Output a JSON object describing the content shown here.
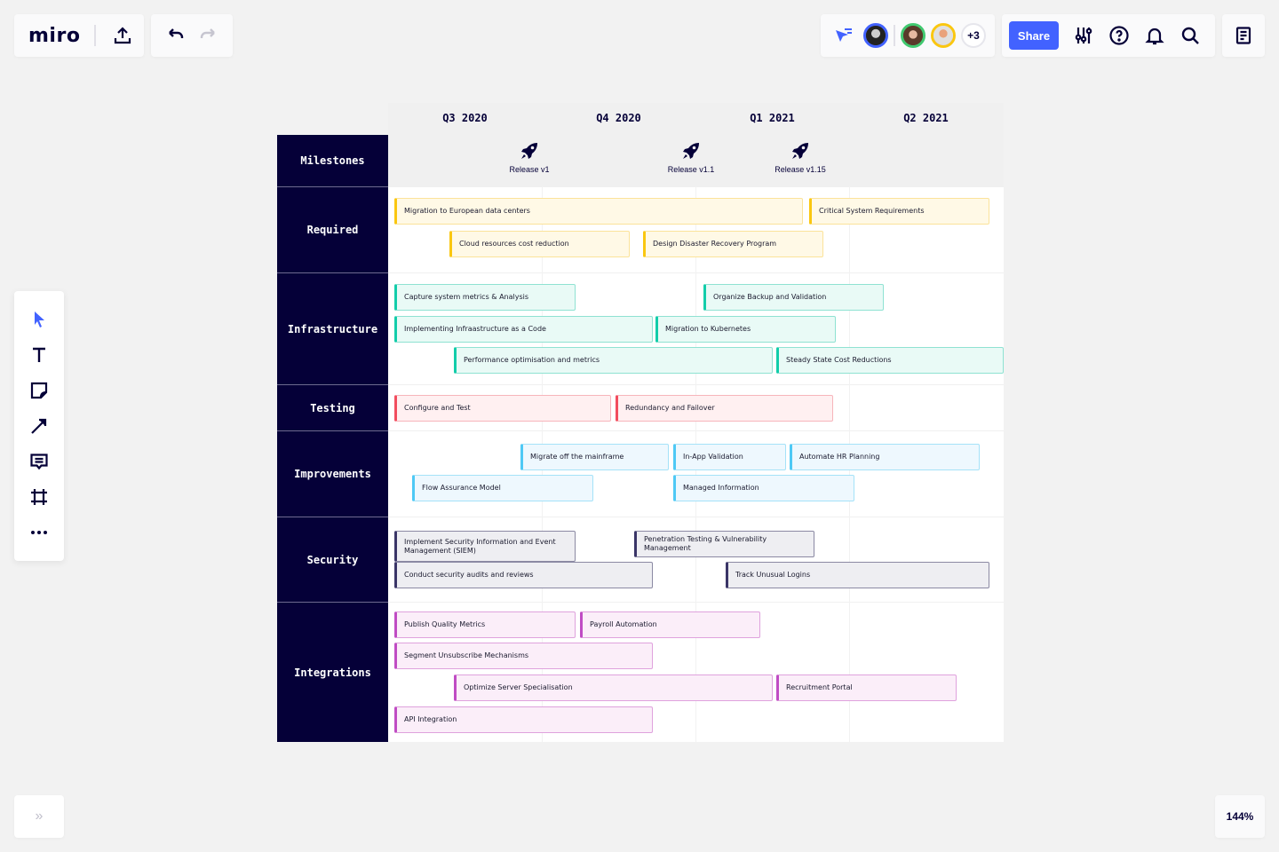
{
  "app": {
    "logo": "miro",
    "share_label": "Share",
    "collaborators_more": "+3",
    "zoom_level": "144%",
    "expand_label": "»"
  },
  "toolbar": {
    "items": [
      "select-tool",
      "text-tool",
      "sticky-note-tool",
      "connection-line-tool",
      "comment-tool",
      "frame-tool",
      "more-tools"
    ]
  },
  "board": {
    "quarters": [
      "Q3 2020",
      "Q4 2020",
      "Q1 2021",
      "Q2 2021"
    ],
    "milestones": [
      {
        "label": "Release v1",
        "icon": "rocket-icon"
      },
      {
        "label": "Release v1.1",
        "icon": "rocket-icon"
      },
      {
        "label": "Release v1.15",
        "icon": "rocket-icon"
      }
    ],
    "lanes": [
      {
        "label": "Milestones"
      },
      {
        "label": "Required",
        "cards": [
          "Migration to European data centers",
          "Critical System Requirements",
          "Cloud resources cost reduction",
          "Design Disaster Recovery Program"
        ]
      },
      {
        "label": "Infrastructure",
        "cards": [
          "Capture system metrics & Analysis",
          "Organize Backup and Validation",
          "Implementing Infraastructure as a Code",
          "Migration to Kubernetes",
          "Performance optimisation and metrics",
          "Steady State Cost Reductions"
        ]
      },
      {
        "label": "Testing",
        "cards": [
          "Configure and Test",
          "Redundancy and Failover"
        ]
      },
      {
        "label": "Improvements",
        "cards": [
          "Migrate off the mainframe",
          "In-App Validation",
          "Automate HR Planning",
          "Flow Assurance Model",
          "Managed Information"
        ]
      },
      {
        "label": "Security",
        "cards": [
          "Implement Security Information and Event Management (SIEM)",
          "Penetration Testing & Vulnerability Management",
          "Conduct security audits and reviews",
          "Track Unusual Logins"
        ]
      },
      {
        "label": "Integrations",
        "cards": [
          "Publish Quality Metrics",
          "Payroll Automation",
          "Segment Unsubscribe Mechanisms",
          "Optimize Server Specialisation",
          "Recruitment Portal",
          "API Integration"
        ]
      }
    ]
  },
  "colors": {
    "accent": "#4262ff",
    "navy": "#050038",
    "required": "#fac710",
    "infrastructure": "#12cdaa",
    "testing": "#f24d5e",
    "improvements": "#4ec9f5",
    "security": "#3a3567",
    "integrations": "#c04cc4"
  }
}
